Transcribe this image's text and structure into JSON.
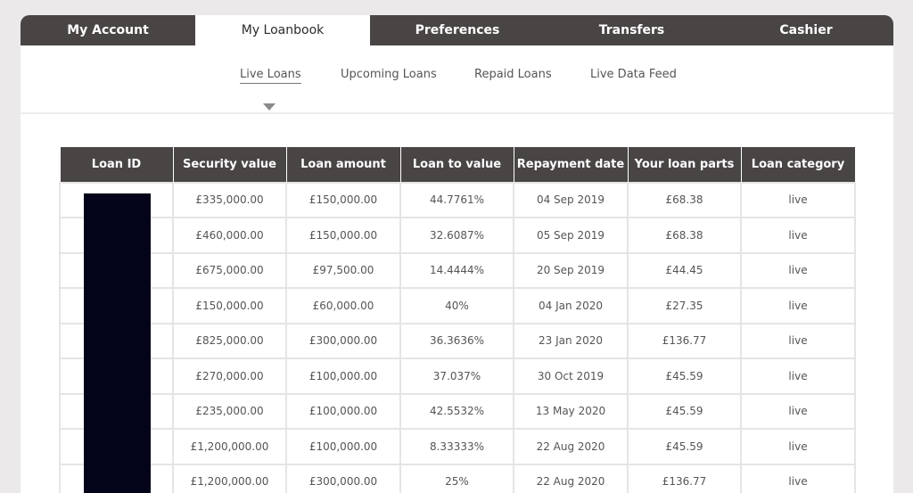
{
  "tabs": [
    "My Account",
    "My Loanbook",
    "Preferences",
    "Transfers",
    "Cashier"
  ],
  "active_tab": "My Loanbook",
  "subnav": [
    "Live Loans",
    "Upcoming Loans",
    "Repaid Loans",
    "Live Data Feed"
  ],
  "active_subnav": "Live Loans",
  "table": {
    "headers": [
      "Loan ID",
      "Security value",
      "Loan amount",
      "Loan to value",
      "Repayment date",
      "Your loan parts",
      "Loan category"
    ],
    "rows": [
      [
        "",
        "£335,000.00",
        "£150,000.00",
        "44.7761%",
        "04 Sep 2019",
        "£68.38",
        "live"
      ],
      [
        "",
        "£460,000.00",
        "£150,000.00",
        "32.6087%",
        "05 Sep 2019",
        "£68.38",
        "live"
      ],
      [
        "",
        "£675,000.00",
        "£97,500.00",
        "14.4444%",
        "20 Sep 2019",
        "£44.45",
        "live"
      ],
      [
        "",
        "£150,000.00",
        "£60,000.00",
        "40%",
        "04 Jan 2020",
        "£27.35",
        "live"
      ],
      [
        "",
        "£825,000.00",
        "£300,000.00",
        "36.3636%",
        "23 Jan 2020",
        "£136.77",
        "live"
      ],
      [
        "",
        "£270,000.00",
        "£100,000.00",
        "37.037%",
        "30 Oct 2019",
        "£45.59",
        "live"
      ],
      [
        "",
        "£235,000.00",
        "£100,000.00",
        "42.5532%",
        "13 May 2020",
        "£45.59",
        "live"
      ],
      [
        "",
        "£1,200,000.00",
        "£100,000.00",
        "8.33333%",
        "22 Aug 2020",
        "£45.59",
        "live"
      ],
      [
        "",
        "£1,200,000.00",
        "£300,000.00",
        "25%",
        "22 Aug 2020",
        "£136.77",
        "live"
      ]
    ]
  },
  "colors": {
    "tab_bar": "#4a4545",
    "background": "#ece9ea",
    "redaction": "#03031a"
  }
}
